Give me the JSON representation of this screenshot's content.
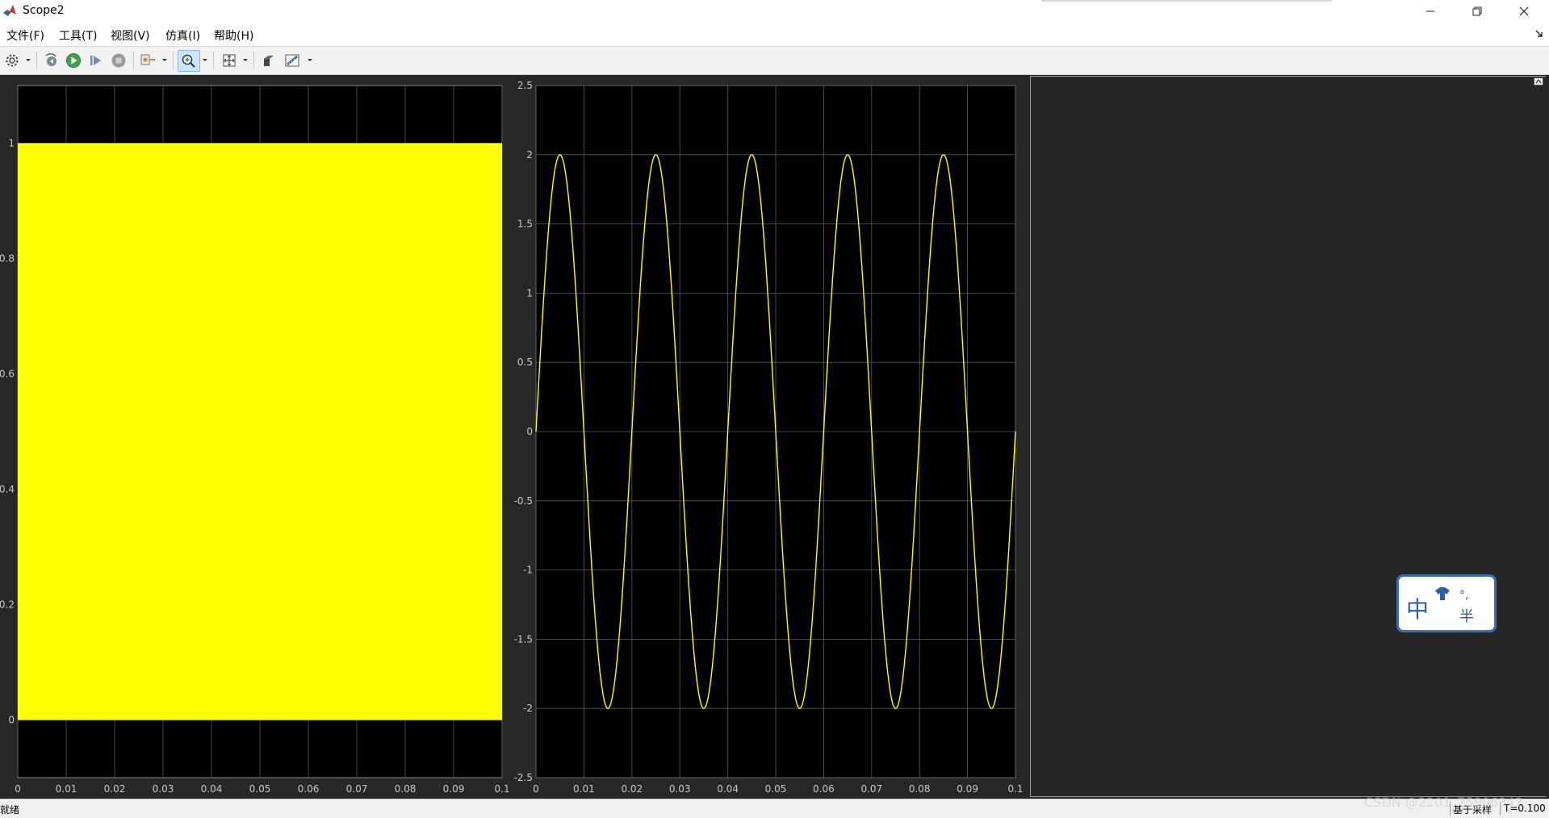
{
  "window": {
    "title": "Scope2",
    "minimize": "—",
    "restore": "❐",
    "close": "✕"
  },
  "menu": [
    "文件(F)",
    "工具(T)",
    "视图(V)",
    "仿真(I)",
    "帮助(H)"
  ],
  "toolbar": {
    "icons": [
      "gear-icon",
      "step-back-icon",
      "run-icon",
      "step-forward-icon",
      "stop-icon",
      "signal-select-icon",
      "zoom-in-icon",
      "fit-axes-icon",
      "style-icon",
      "measure-icon"
    ],
    "zoom_active": true
  },
  "colors": {
    "plot_bg": "#000000",
    "trace": "#ffff00",
    "panel_bg": "#272727",
    "axis_label": "#c8c8c8",
    "grid": "#5a5a5a"
  },
  "statusbar": {
    "ready": "就绪",
    "mode": "基于采样",
    "time": "T=0.100"
  },
  "watermark": "CSDN @2201_75906342",
  "ime": {
    "char1": "中",
    "char2": "半",
    "char3": "°,"
  },
  "chart_data": [
    {
      "type": "area",
      "xlim": [
        0,
        0.1
      ],
      "ylim": [
        -0.1,
        1.1
      ],
      "x_ticks": [
        "0",
        "0.01",
        "0.02",
        "0.03",
        "0.04",
        "0.05",
        "0.06",
        "0.07",
        "0.08",
        "0.09",
        "0.1"
      ],
      "y_ticks": [
        "0",
        "0.2",
        "0.4",
        "0.6",
        "0.8",
        "1"
      ],
      "y_tick_values": [
        0,
        0.2,
        0.4,
        0.6,
        0.8,
        1
      ],
      "series": [
        {
          "values_range": [
            0,
            1
          ]
        }
      ],
      "grid": true
    },
    {
      "type": "line",
      "xlim": [
        0,
        0.1
      ],
      "ylim": [
        -2.5,
        2.5
      ],
      "x_ticks": [
        "0",
        "0.01",
        "0.02",
        "0.03",
        "0.04",
        "0.05",
        "0.06",
        "0.07",
        "0.08",
        "0.09",
        "0.1"
      ],
      "y_ticks": [
        "-2.5",
        "-2",
        "-1.5",
        "-1",
        "-0.5",
        "0",
        "0.5",
        "1",
        "1.5",
        "2",
        "2.5"
      ],
      "y_tick_values": [
        -2.5,
        -2,
        -1.5,
        -1,
        -0.5,
        0,
        0.5,
        1,
        1.5,
        2,
        2.5
      ],
      "series": [
        {
          "amplitude": 2,
          "frequency_hz": 50,
          "phase": 0
        }
      ],
      "grid": true
    }
  ]
}
